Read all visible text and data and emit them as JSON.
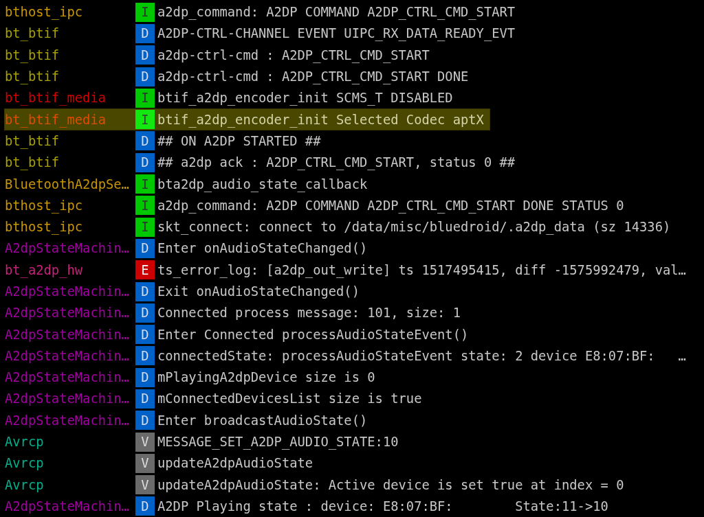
{
  "log": [
    {
      "tag": "bthost_ipc",
      "color": "#c89600",
      "priority": "I",
      "kind": "info",
      "message": "a2dp_command: A2DP COMMAND A2DP_CTRL_CMD_START",
      "selected": false
    },
    {
      "tag": "bt_btif",
      "color": "#a8a000",
      "priority": "D",
      "kind": "debug",
      "message": "A2DP-CTRL-CHANNEL EVENT UIPC_RX_DATA_READY_EVT",
      "selected": false
    },
    {
      "tag": "bt_btif",
      "color": "#a8a000",
      "priority": "D",
      "kind": "debug",
      "message": "a2dp-ctrl-cmd : A2DP_CTRL_CMD_START",
      "selected": false
    },
    {
      "tag": "bt_btif",
      "color": "#a8a000",
      "priority": "D",
      "kind": "debug",
      "message": "a2dp-ctrl-cmd : A2DP_CTRL_CMD_START DONE",
      "selected": false
    },
    {
      "tag": "bt_btif_media",
      "color": "#d20000",
      "priority": "I",
      "kind": "info",
      "message": "btif_a2dp_encoder_init SCMS_T DISABLED",
      "selected": false
    },
    {
      "tag": "bt_btif_media",
      "color": "#e04c00",
      "priority": "I",
      "kind": "info",
      "message": "btif_a2dp_encoder_init Selected Codec aptX",
      "selected": true
    },
    {
      "tag": "bt_btif",
      "color": "#a8a000",
      "priority": "D",
      "kind": "debug",
      "message": "## ON A2DP STARTED ##",
      "selected": false
    },
    {
      "tag": "bt_btif",
      "color": "#a8a000",
      "priority": "D",
      "kind": "debug",
      "message": "## a2dp ack : A2DP_CTRL_CMD_START, status 0 ##",
      "selected": false
    },
    {
      "tag": "BluetoothA2dpSe…",
      "color": "#c89600",
      "priority": "I",
      "kind": "info",
      "message": "bta2dp_audio_state_callback",
      "selected": false
    },
    {
      "tag": "bthost_ipc",
      "color": "#c89600",
      "priority": "I",
      "kind": "info",
      "message": "a2dp_command: A2DP COMMAND A2DP_CTRL_CMD_START DONE STATUS 0",
      "selected": false
    },
    {
      "tag": "bthost_ipc",
      "color": "#c89600",
      "priority": "I",
      "kind": "info",
      "message": "skt_connect: connect to /data/misc/bluedroid/.a2dp_data (sz 14336)",
      "selected": false
    },
    {
      "tag": "A2dpStateMachin…",
      "color": "#a000a0",
      "priority": "D",
      "kind": "debug",
      "message": "Enter onAudioStateChanged()",
      "selected": false
    },
    {
      "tag": "bt_a2dp_hw",
      "color": "#c8207a",
      "priority": "E",
      "kind": "error",
      "message": "ts_error_log: [a2dp_out_write] ts 1517495415, diff -1575992479, val…",
      "selected": false
    },
    {
      "tag": "A2dpStateMachin…",
      "color": "#a000a0",
      "priority": "D",
      "kind": "debug",
      "message": "Exit onAudioStateChanged()",
      "selected": false
    },
    {
      "tag": "A2dpStateMachin…",
      "color": "#a000a0",
      "priority": "D",
      "kind": "debug",
      "message": "Connected process message: 101, size: 1",
      "selected": false
    },
    {
      "tag": "A2dpStateMachin…",
      "color": "#a000a0",
      "priority": "D",
      "kind": "debug",
      "message": "Enter Connected processAudioStateEvent()",
      "selected": false
    },
    {
      "tag": "A2dpStateMachin…",
      "color": "#a000a0",
      "priority": "D",
      "kind": "debug",
      "message": "connectedState: processAudioStateEvent state: 2 device E8:07:BF:   …",
      "selected": false
    },
    {
      "tag": "A2dpStateMachin…",
      "color": "#a000a0",
      "priority": "D",
      "kind": "debug",
      "message": "mPlayingA2dpDevice size is 0",
      "selected": false
    },
    {
      "tag": "A2dpStateMachin…",
      "color": "#a000a0",
      "priority": "D",
      "kind": "debug",
      "message": "mConnectedDevicesList size is true",
      "selected": false
    },
    {
      "tag": "A2dpStateMachin…",
      "color": "#a000a0",
      "priority": "D",
      "kind": "debug",
      "message": "Enter broadcastAudioState()",
      "selected": false
    },
    {
      "tag": "Avrcp",
      "color": "#00b08c",
      "priority": "V",
      "kind": "verbose",
      "message": "MESSAGE_SET_A2DP_AUDIO_STATE:10",
      "selected": false
    },
    {
      "tag": "Avrcp",
      "color": "#00b08c",
      "priority": "V",
      "kind": "verbose",
      "message": "updateA2dpAudioState",
      "selected": false
    },
    {
      "tag": "Avrcp",
      "color": "#00b08c",
      "priority": "V",
      "kind": "verbose",
      "message": "updateA2dpAudioState: Active device is set true at index = 0",
      "selected": false
    },
    {
      "tag": "A2dpStateMachin…",
      "color": "#a000a0",
      "priority": "D",
      "kind": "debug",
      "message": "A2DP Playing state : device: E8:07:BF:        State:11->10",
      "selected": false
    }
  ]
}
